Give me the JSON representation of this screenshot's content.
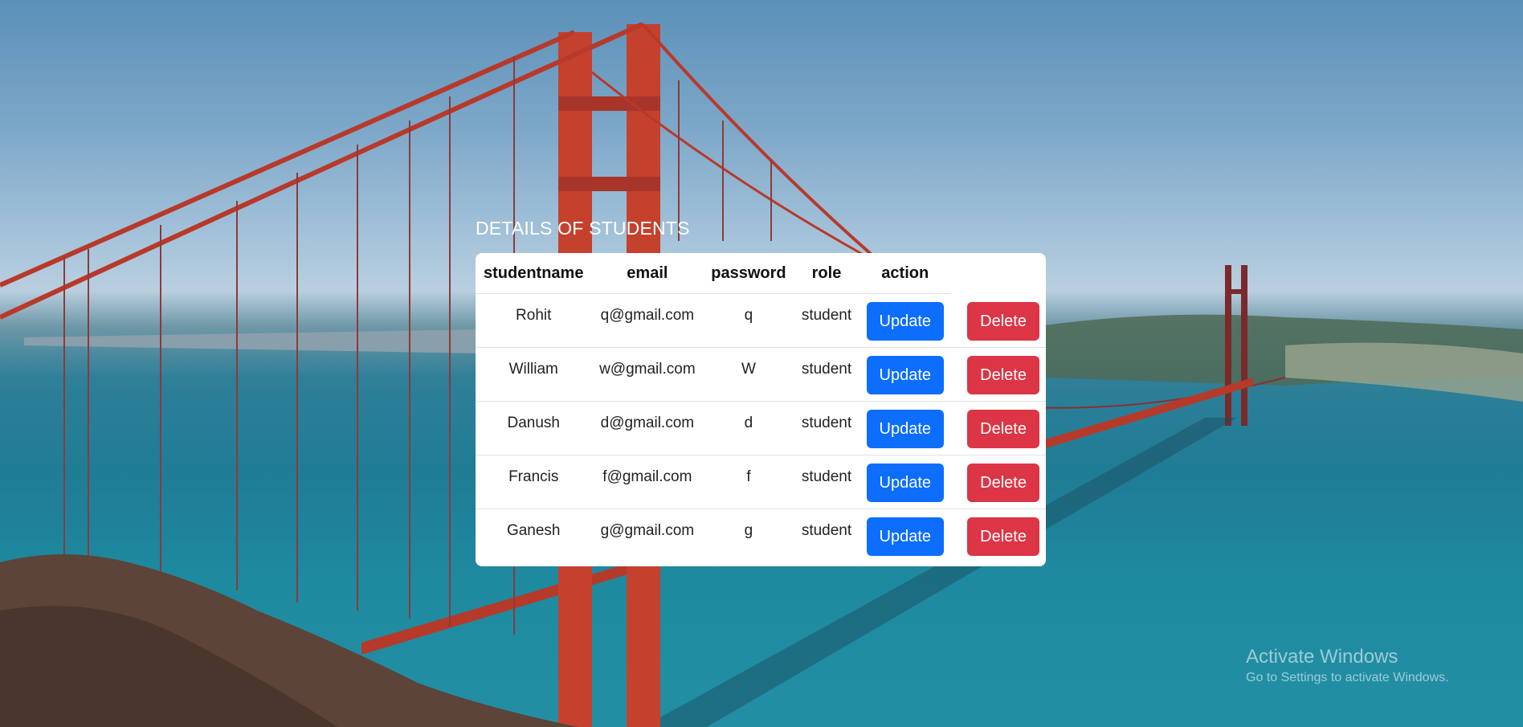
{
  "page": {
    "title": "DETAILS OF STUDENTS"
  },
  "table": {
    "columns": [
      "studentname",
      "email",
      "password",
      "role",
      "action"
    ],
    "update_label": "Update",
    "delete_label": "Delete",
    "rows": [
      {
        "studentname": "Rohit",
        "email": "q@gmail.com",
        "password": "q",
        "role": "student"
      },
      {
        "studentname": "William",
        "email": "w@gmail.com",
        "password": "W",
        "role": "student"
      },
      {
        "studentname": "Danush",
        "email": "d@gmail.com",
        "password": "d",
        "role": "student"
      },
      {
        "studentname": "Francis",
        "email": "f@gmail.com",
        "password": "f",
        "role": "student"
      },
      {
        "studentname": "Ganesh",
        "email": "g@gmail.com",
        "password": "g",
        "role": "student"
      }
    ]
  },
  "watermark": {
    "line1": "Activate Windows",
    "line2": "Go to Settings to activate Windows."
  },
  "colors": {
    "update": "#0d6efd",
    "delete": "#dc3545",
    "bridge": "#c0392b"
  },
  "background": {
    "icon": "golden-gate-bridge-photo"
  }
}
